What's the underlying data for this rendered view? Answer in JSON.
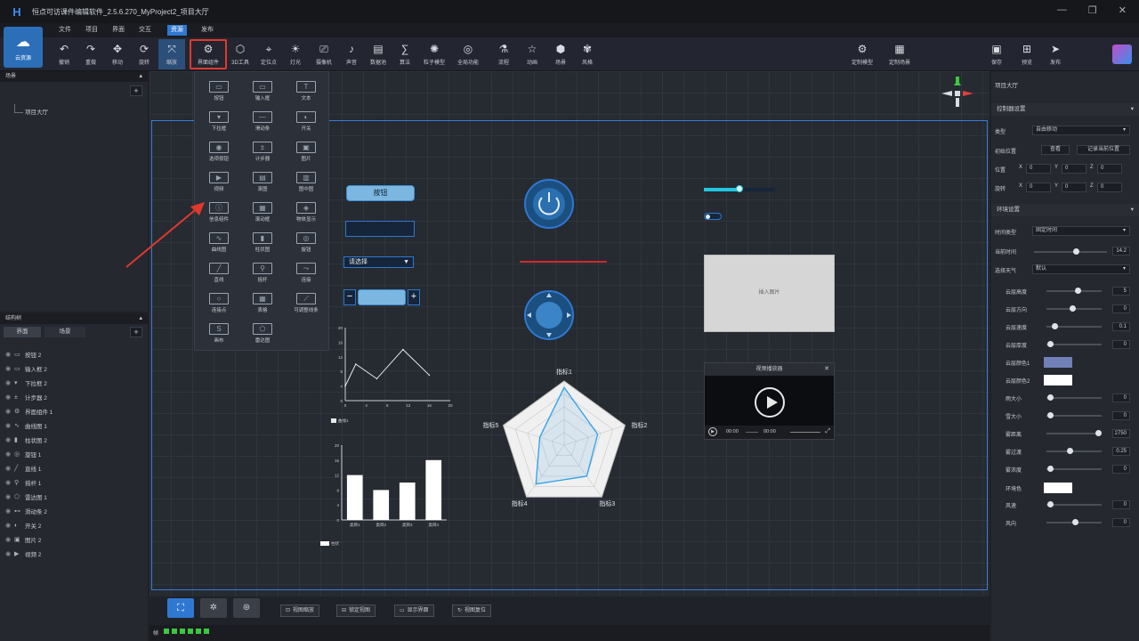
{
  "app": {
    "logo": "H",
    "title": "恒点可访课件编辑软件_2.5.6.270_MyProject2_项目大厅"
  },
  "window_controls": {
    "minimize": "—",
    "restore": "❐",
    "close": "✕"
  },
  "menu": [
    "文件",
    "项目",
    "界面",
    "交互",
    "资源",
    "发布"
  ],
  "menu_active": "资源",
  "cloud": {
    "label": "云资源"
  },
  "toolbar": [
    {
      "label": "撤销",
      "icon": "undo-icon"
    },
    {
      "label": "重做",
      "icon": "redo-icon"
    },
    {
      "label": "移动",
      "icon": "move-icon"
    },
    {
      "label": "旋转",
      "icon": "rotate-icon"
    },
    {
      "label": "缩放",
      "icon": "scale-icon"
    },
    {
      "label": "界面组件",
      "icon": "ui-components-icon"
    },
    {
      "label": "3D工具",
      "icon": "3d-tool-icon"
    },
    {
      "label": "定位点",
      "icon": "locator-icon"
    },
    {
      "label": "灯光",
      "icon": "light-icon"
    },
    {
      "label": "摄像机",
      "icon": "camera-icon"
    },
    {
      "label": "声音",
      "icon": "sound-icon"
    },
    {
      "label": "数据池",
      "icon": "data-pool-icon"
    },
    {
      "label": "算法",
      "icon": "algorithm-icon"
    },
    {
      "label": "粒子模型",
      "icon": "particle-icon"
    },
    {
      "label": "全局功能",
      "icon": "global-icon"
    },
    {
      "label": "流程",
      "icon": "flow-icon"
    },
    {
      "label": "动画",
      "icon": "animation-icon"
    },
    {
      "label": "场景",
      "icon": "scene-icon"
    },
    {
      "label": "风格",
      "icon": "style-icon"
    }
  ],
  "toolbar_right": [
    {
      "label": "定制模型",
      "icon": "custom-model-icon"
    },
    {
      "label": "定制场景",
      "icon": "custom-scene-icon"
    },
    {
      "label": "保存",
      "icon": "save-icon"
    },
    {
      "label": "预览",
      "icon": "preview-icon"
    },
    {
      "label": "发布",
      "icon": "publish-icon"
    }
  ],
  "left_top": {
    "header": "场景",
    "add": "+",
    "tree_item": "项目大厅"
  },
  "left_bottom": {
    "header": "结构树",
    "tabs": [
      "界面",
      "场景"
    ],
    "add": "+",
    "layers": [
      {
        "name": "按钮 2",
        "icon": "button-icon"
      },
      {
        "name": "输入框 2",
        "icon": "input-icon"
      },
      {
        "name": "下拉框 2",
        "icon": "dropdown-icon"
      },
      {
        "name": "计步器 2",
        "icon": "stepper-icon"
      },
      {
        "name": "界面组件 1",
        "icon": "ui-components-icon"
      },
      {
        "name": "曲线图 1",
        "icon": "curve-chart-icon"
      },
      {
        "name": "柱状图 2",
        "icon": "bar-chart-icon"
      },
      {
        "name": "旋钮 1",
        "icon": "knob-icon"
      },
      {
        "name": "直线 1",
        "icon": "line-icon"
      },
      {
        "name": "摇杆 1",
        "icon": "joystick-icon"
      },
      {
        "name": "雷达图 1",
        "icon": "radar-chart-icon"
      },
      {
        "name": "滑动条 2",
        "icon": "slider-icon"
      },
      {
        "name": "开关 2",
        "icon": "switch-icon"
      },
      {
        "name": "图片 2",
        "icon": "image-icon"
      },
      {
        "name": "视频 2",
        "icon": "video-icon"
      }
    ]
  },
  "popup": [
    {
      "label": "按钮",
      "glyph": "▭"
    },
    {
      "label": "输入框",
      "glyph": "▭"
    },
    {
      "label": "文本",
      "glyph": "T"
    },
    {
      "label": "下拉框",
      "glyph": "▾"
    },
    {
      "label": "滑动条",
      "glyph": "—"
    },
    {
      "label": "开关",
      "glyph": "◐"
    },
    {
      "label": "选项按钮",
      "glyph": "◉"
    },
    {
      "label": "计步器",
      "glyph": "±"
    },
    {
      "label": "图片",
      "glyph": "▣"
    },
    {
      "label": "视频",
      "glyph": "▶"
    },
    {
      "label": "滚图",
      "glyph": "▤"
    },
    {
      "label": "图中图",
      "glyph": "▥"
    },
    {
      "label": "信息组件",
      "glyph": "ⓘ"
    },
    {
      "label": "滚动框",
      "glyph": "▦"
    },
    {
      "label": "物体显示",
      "glyph": "◈"
    },
    {
      "label": "曲线图",
      "glyph": "∿"
    },
    {
      "label": "柱状图",
      "glyph": "▮"
    },
    {
      "label": "旋钮",
      "glyph": "◎"
    },
    {
      "label": "直线",
      "glyph": "╱"
    },
    {
      "label": "摇杆",
      "glyph": "⚲"
    },
    {
      "label": "连接",
      "glyph": "⤳"
    },
    {
      "label": "连接点",
      "glyph": "○"
    },
    {
      "label": "表格",
      "glyph": "▦"
    },
    {
      "label": "可调整线条",
      "glyph": "⟋"
    },
    {
      "label": "画布",
      "glyph": "S"
    },
    {
      "label": "雷达图",
      "glyph": "⬠"
    }
  ],
  "canvas": {
    "button_label": "按钮",
    "dropdown_value": "请选择",
    "stepper_minus": "−",
    "stepper_plus": "+",
    "image_placeholder": "插入图片",
    "video_title": "视频播放器",
    "video_close": "✕",
    "video_time_start": "00:00",
    "video_time_end": "00:00"
  },
  "colors": {
    "accent": "#2f78d1",
    "highlight": "#e1382e",
    "stage_border": "#3c7bd6",
    "slider_accent": "#1fc8e0",
    "chart_line": "#2ea0e8"
  },
  "chart_data": [
    {
      "type": "line",
      "x": [
        0,
        2,
        6,
        11,
        16
      ],
      "values": [
        4,
        10,
        6,
        14,
        7
      ],
      "xticks": [
        "0",
        "4",
        "8",
        "12",
        "16",
        "20"
      ],
      "yticks": [
        "0",
        "4",
        "8",
        "12",
        "16",
        "20"
      ],
      "xlim": [
        0,
        20
      ],
      "ylim": [
        0,
        20
      ],
      "legend": "曲线1"
    },
    {
      "type": "bar",
      "categories": [
        "类目1",
        "类目2",
        "类目3",
        "类目4"
      ],
      "values": [
        12,
        8,
        10,
        16
      ],
      "yticks": [
        "0",
        "4",
        "8",
        "12",
        "16",
        "20"
      ],
      "ylim": [
        0,
        20
      ],
      "legend": "柱状"
    },
    {
      "type": "radar",
      "axes": [
        "指标1",
        "指标2",
        "指标3",
        "指标4",
        "指标5"
      ],
      "values": [
        0.9,
        0.55,
        0.6,
        0.75,
        0.4
      ],
      "range": [
        0,
        1
      ]
    }
  ],
  "props": {
    "hdr": "项目大厅",
    "sec1": "控制器设置",
    "type_label": "类型",
    "type_value": "自由移动",
    "init_pos_label": "初始位置",
    "view_btn": "查看",
    "record_btn": "记录当前位置",
    "pos_label": "位置",
    "rot_label": "旋转",
    "x": "X",
    "y": "Y",
    "z": "Z",
    "zero": "0",
    "sec2": "环境设置",
    "time_type_label": "时间类型",
    "time_type_value": "固定时间",
    "cur_time_label": "当前时间",
    "cur_time_value": "14.2",
    "weather_label": "选择天气",
    "weather_value": "默认",
    "rows": [
      {
        "label": "云层高度",
        "value": "5",
        "t": 0.55
      },
      {
        "label": "云层方向",
        "value": "0",
        "t": 0.45
      },
      {
        "label": "云层速度",
        "value": "0.1",
        "t": 0.1
      },
      {
        "label": "云层厚度",
        "value": "0",
        "t": 0.02
      }
    ],
    "color1_label": "云层颜色1",
    "color1": "#7280b8",
    "color2_label": "云层颜色2",
    "color2": "#ffffff",
    "rows2": [
      {
        "label": "雨大小",
        "value": "0",
        "t": 0.02
      },
      {
        "label": "雪大小",
        "value": "0",
        "t": 0.02
      },
      {
        "label": "雾距离",
        "value": "2750",
        "t": 0.95
      },
      {
        "label": "雾过渡",
        "value": "0.25",
        "t": 0.4
      },
      {
        "label": "雾浓度",
        "value": "0",
        "t": 0.02
      }
    ],
    "fog_color_label": "环境色",
    "fog_color": "#ffffff",
    "rows3": [
      {
        "label": "风速",
        "value": "0",
        "t": 0.02
      },
      {
        "label": "风向",
        "value": "0",
        "t": 0.5
      }
    ]
  },
  "bottom": {
    "buttons": [
      "视图缩放",
      "锁定视图",
      "显示界面",
      "视图复位"
    ],
    "status": "帧"
  }
}
